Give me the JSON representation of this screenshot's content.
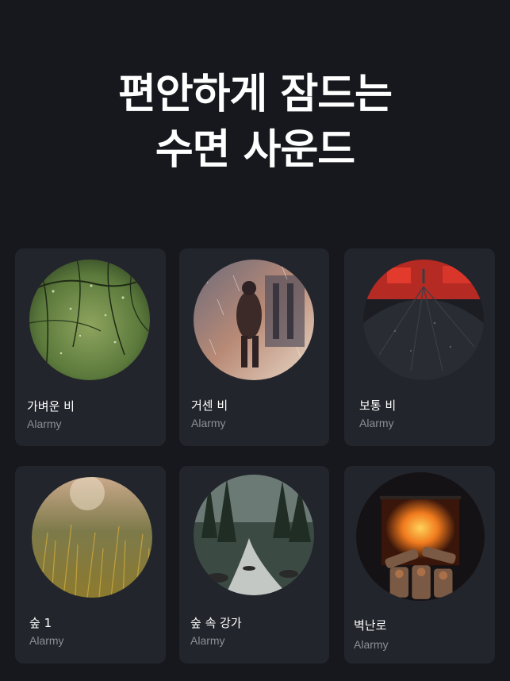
{
  "headline": {
    "line1": "편안하게 잠드는",
    "line2": "수면 사운드"
  },
  "sounds": [
    {
      "title": "가벼운 비",
      "artist": "Alarmy",
      "image": "rain-branches-image"
    },
    {
      "title": "거센 비",
      "artist": "Alarmy",
      "image": "person-in-heavy-rain-image"
    },
    {
      "title": "보통 비",
      "artist": "Alarmy",
      "image": "black-umbrella-image"
    },
    {
      "title": "숲 1",
      "artist": "Alarmy",
      "image": "forest-grass-image"
    },
    {
      "title": "숲 속 강가",
      "artist": "Alarmy",
      "image": "forest-stream-image"
    },
    {
      "title": "벽난로",
      "artist": "Alarmy",
      "image": "fireplace-image"
    }
  ],
  "colors": {
    "background": "#16181d",
    "card": "#23252c",
    "title": "#ffffff",
    "subtitle": "#8c8f97"
  }
}
